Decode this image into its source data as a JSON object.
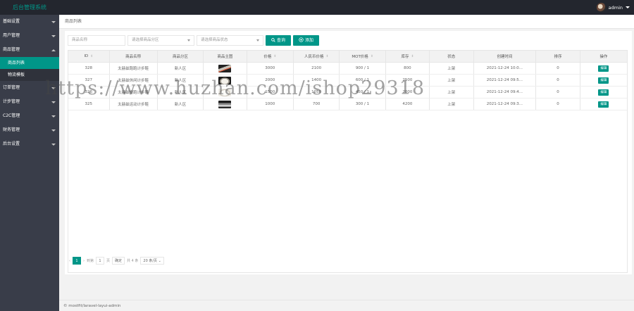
{
  "app": {
    "title": "后台管理系统",
    "user": "admin"
  },
  "sidebar": {
    "items": [
      {
        "label": "基础设置",
        "expanded": false
      },
      {
        "label": "用户管理",
        "expanded": false
      },
      {
        "label": "商品管理",
        "expanded": true
      },
      {
        "label": "订单管理",
        "expanded": false
      },
      {
        "label": "计步管理",
        "expanded": false
      },
      {
        "label": "C2C管理",
        "expanded": false
      },
      {
        "label": "财务管理",
        "expanded": false
      },
      {
        "label": "后台设置",
        "expanded": false
      }
    ],
    "sub_items": [
      {
        "label": "商品列表",
        "active": true
      },
      {
        "label": "物流模板",
        "active": false
      }
    ]
  },
  "breadcrumb": "商品列表",
  "search": {
    "name_placeholder": "商品名称",
    "category_placeholder": "请选择商品分区",
    "status_placeholder": "请选择商品状态",
    "query_label": "查询",
    "add_label": "添加"
  },
  "table": {
    "headers": [
      "ID",
      "商品名称",
      "商品分区",
      "商品主图",
      "价格",
      "人民币价格",
      "MOT价格",
      "库存",
      "状态",
      "创建时间",
      "排序",
      "操作"
    ],
    "rows": [
      {
        "id": "328",
        "name": "太赫兹跑跑计步鞋",
        "category": "新人区",
        "thumb": "shoe-image-black",
        "price": "3000",
        "rmb_price": "2100",
        "mot_price": "900 / 1",
        "stock": "800",
        "status": "上架",
        "created": "2021-12-24 10:0...",
        "sort": "0",
        "action": "编辑"
      },
      {
        "id": "327",
        "name": "太赫兹休闲计步鞋",
        "category": "新人区",
        "thumb": "shoe-image-white",
        "price": "2000",
        "rmb_price": "1400",
        "mot_price": "600 / 1",
        "stock": "2500",
        "status": "上架",
        "created": "2021-12-24 09:5...",
        "sort": "0",
        "action": "编辑"
      },
      {
        "id": "326",
        "name": "太赫兹慢跑计步鞋",
        "category": "新人区",
        "thumb": "shoe-image-white",
        "price": "1500",
        "rmb_price": "1050",
        "mot_price": "450 / 1",
        "stock": "2000",
        "status": "上架",
        "created": "2021-12-24 09:4...",
        "sort": "0",
        "action": "编辑"
      },
      {
        "id": "325",
        "name": "太赫兹运动计步鞋",
        "category": "新人区",
        "thumb": "shoe-image-grey",
        "price": "1000",
        "rmb_price": "700",
        "mot_price": "300 / 1",
        "stock": "4200",
        "status": "上架",
        "created": "2021-12-24 09:3...",
        "sort": "0",
        "action": "编辑"
      }
    ]
  },
  "pager": {
    "prev": "‹",
    "current_page": "1",
    "next": "›",
    "goto_label": "到第",
    "goto_value": "1",
    "page_suffix": "页",
    "confirm": "确定",
    "total": "共 4 条",
    "per_page": "20 条/页"
  },
  "footer": "© mostfit/laravel-layui-admin",
  "watermark": "https://www.huzhan.com/ishop29318",
  "colors": {
    "accent": "#009688",
    "topbar": "#23262e",
    "sidebar": "#393d49"
  }
}
